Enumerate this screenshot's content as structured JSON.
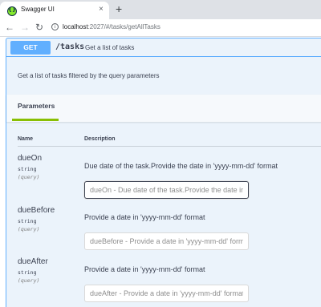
{
  "browser": {
    "tab_title": "Swagger UI",
    "tab_close": "×",
    "new_tab": "+",
    "url_host": "localhost",
    "url_rest": ":2027/#/tasks/getAllTasks"
  },
  "operation": {
    "method": "GET",
    "path": "/tasks",
    "summary": "Get a list of tasks",
    "description": "Get a list of tasks filtered by the query parameters"
  },
  "parameters_section": {
    "tab_label": "Parameters",
    "columns": {
      "name": "Name",
      "description": "Description"
    },
    "params": [
      {
        "name": "dueOn",
        "type": "string",
        "in": "(query)",
        "description": "Due date of the task.Provide the date in 'yyyy-mm-dd' format",
        "placeholder": "dueOn - Due date of the task.Provide the date in 'yyyy-mm-dd' format"
      },
      {
        "name": "dueBefore",
        "type": "string",
        "in": "(query)",
        "description": "Provide a date in 'yyyy-mm-dd' format",
        "placeholder": "dueBefore - Provide a date in 'yyyy-mm-dd' format"
      },
      {
        "name": "dueAfter",
        "type": "string",
        "in": "(query)",
        "description": "Provide a date in 'yyyy-mm-dd' format",
        "placeholder": "dueAfter - Provide a date in 'yyyy-mm-dd' format"
      }
    ]
  },
  "colors": {
    "get_blue": "#61affe",
    "opblock_bg": "#ebf3fb",
    "tab_accent": "#89bf04",
    "text": "#3b4151"
  },
  "icons": [
    "swagger-favicon",
    "close-icon",
    "plus-icon",
    "back-arrow-icon",
    "forward-arrow-icon",
    "reload-icon",
    "info-icon"
  ]
}
